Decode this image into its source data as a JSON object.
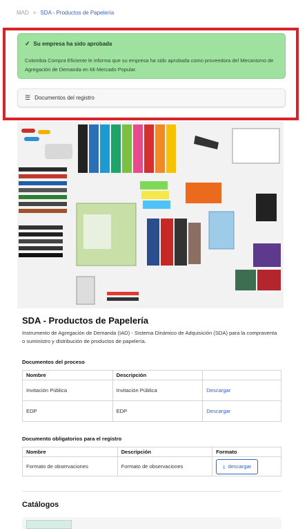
{
  "breadcrumb": {
    "root": "MAD",
    "separator": ">",
    "current": "SDA - Productos de Papelería"
  },
  "alert": {
    "title": "Su empresa ha sido aprobada",
    "body": "Colombia Compra Eficiente le informa que su empresa ha sido aprobada como proveedora del Mecanismo de Agregación de Demanda en Mi Mercado Popular."
  },
  "docs_registro": {
    "label": "Documentos del registro"
  },
  "colors": {
    "highlight_frame": "#d8232a",
    "alert_bg": "#9fe2a0",
    "link": "#2f63c6"
  },
  "product": {
    "title": "SDA - Productos de Papelería",
    "description": "Instrumento de Agregación de Demanda (IAD) - Sistema Dinámico de Adquisición (SDA) para la compraventa o suministro y distribución de productos de papelería."
  },
  "docs_proceso": {
    "label": "Documentos del proceso",
    "headers": [
      "Nombre",
      "Descripción",
      ""
    ],
    "rows": [
      {
        "nombre": "Invitación Pública",
        "descripcion": "Invitación Pública",
        "accion": "Descargar"
      },
      {
        "nombre": "EDP",
        "descripcion": "EDP",
        "accion": "Descargar"
      }
    ]
  },
  "docs_obligatorios": {
    "label": "Documento obligatorios para el registro",
    "headers": [
      "Nombre",
      "Descripción",
      "Formato"
    ],
    "rows": [
      {
        "nombre": "Formato de observaciones",
        "descripcion": "Formato de observaciones",
        "accion": "descargar",
        "icon": "download-icon"
      }
    ]
  },
  "catalogos": {
    "label": "Catálogos"
  }
}
